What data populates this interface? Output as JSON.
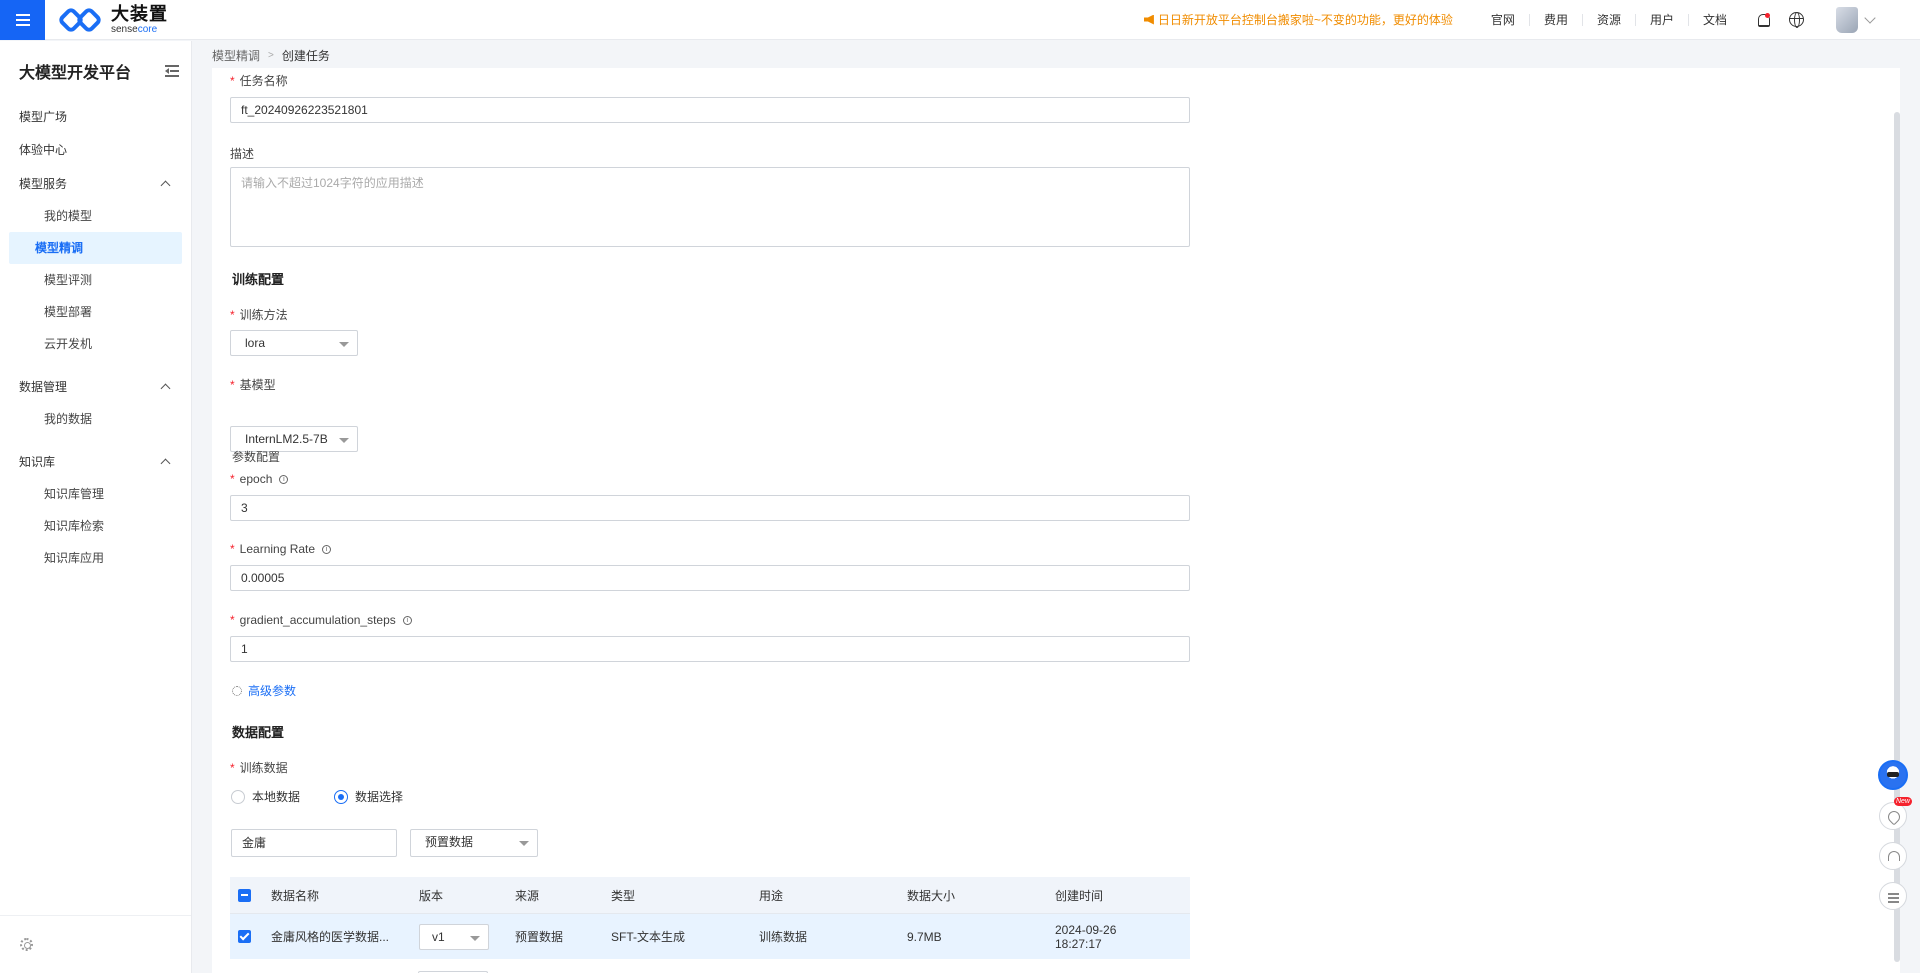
{
  "topbar": {
    "logo_cn": "大装置",
    "logo_en_a": "sense",
    "logo_en_b": "core",
    "announcement": "日日新开放平台控制台搬家啦~不变的功能，更好的体验",
    "links": [
      "官网",
      "费用",
      "资源",
      "用户",
      "文档"
    ]
  },
  "sidebar": {
    "title": "大模型开发平台",
    "items": {
      "model_plaza": "模型广场",
      "experience": "体验中心",
      "model_service": "模型服务",
      "my_models": "我的模型",
      "fine_tune": "模型精调",
      "evaluate": "模型评测",
      "deploy": "模型部署",
      "cloud_dev": "云开发机",
      "data_mgmt": "数据管理",
      "my_data": "我的数据",
      "knowledge": "知识库",
      "kb_manage": "知识库管理",
      "kb_search": "知识库检索",
      "kb_app": "知识库应用"
    }
  },
  "breadcrumb": {
    "parent": "模型精调",
    "separator": ">",
    "current": "创建任务"
  },
  "form": {
    "task_name_label": "任务名称",
    "task_name_value": "ft_20240926223521801",
    "desc_label": "描述",
    "desc_placeholder": "请输入不超过1024字符的应用描述",
    "train_config_title": "训练配置",
    "method_label": "训练方法",
    "method_value": "lora",
    "base_model_label": "基模型",
    "base_model_value": "InternLM2.5-7B",
    "param_config_label": "参数配置",
    "epoch_label": "epoch",
    "epoch_value": "3",
    "lr_label": "Learning Rate",
    "lr_value": "0.00005",
    "gas_label": "gradient_accumulation_steps",
    "gas_value": "1",
    "advanced_label": "高级参数",
    "data_config_title": "数据配置",
    "train_data_label": "训练数据",
    "radio_local": "本地数据",
    "radio_select": "数据选择",
    "search_value": "金庸",
    "filter_value": "预置数据",
    "info_glyph": "i",
    "required_mark": "*"
  },
  "table": {
    "headers": [
      "数据名称",
      "版本",
      "来源",
      "类型",
      "用途",
      "数据大小",
      "创建时间"
    ],
    "rows": [
      {
        "name": "金庸风格的医学数据...",
        "version": "v1",
        "source": "预置数据",
        "type": "SFT-文本生成",
        "usage": "训练数据",
        "size": "9.7MB",
        "created": "2024-09-26 18:27:17"
      }
    ]
  },
  "float_tools": {
    "new_badge": "New"
  },
  "colors": {
    "primary": "#1a6ef5",
    "announce": "#f08c00",
    "required": "#f5222d",
    "active_bg": "#e6f4ff"
  }
}
